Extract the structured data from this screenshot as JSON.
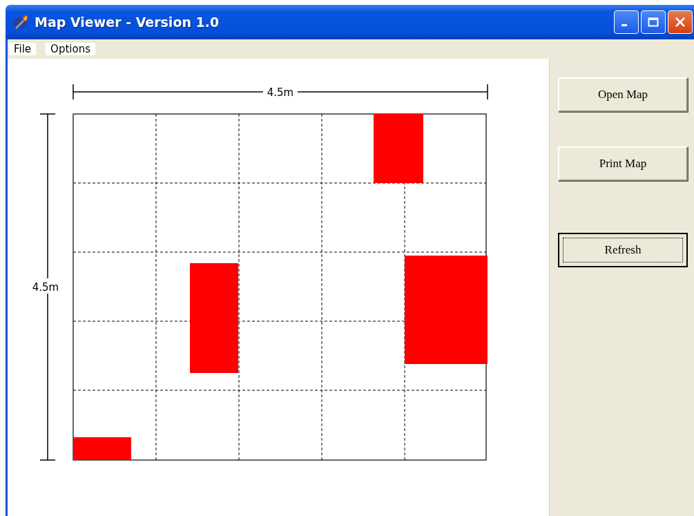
{
  "window": {
    "title": "Map Viewer - Version 1.0"
  },
  "menu": [
    "File",
    "Options"
  ],
  "map": {
    "width_label": "4.5m",
    "height_label": "4.5m"
  },
  "buttons": [
    {
      "label": "Open Map",
      "focused": false
    },
    {
      "label": "Print Map",
      "focused": false
    },
    {
      "label": "Refresh",
      "focused": true
    }
  ]
}
